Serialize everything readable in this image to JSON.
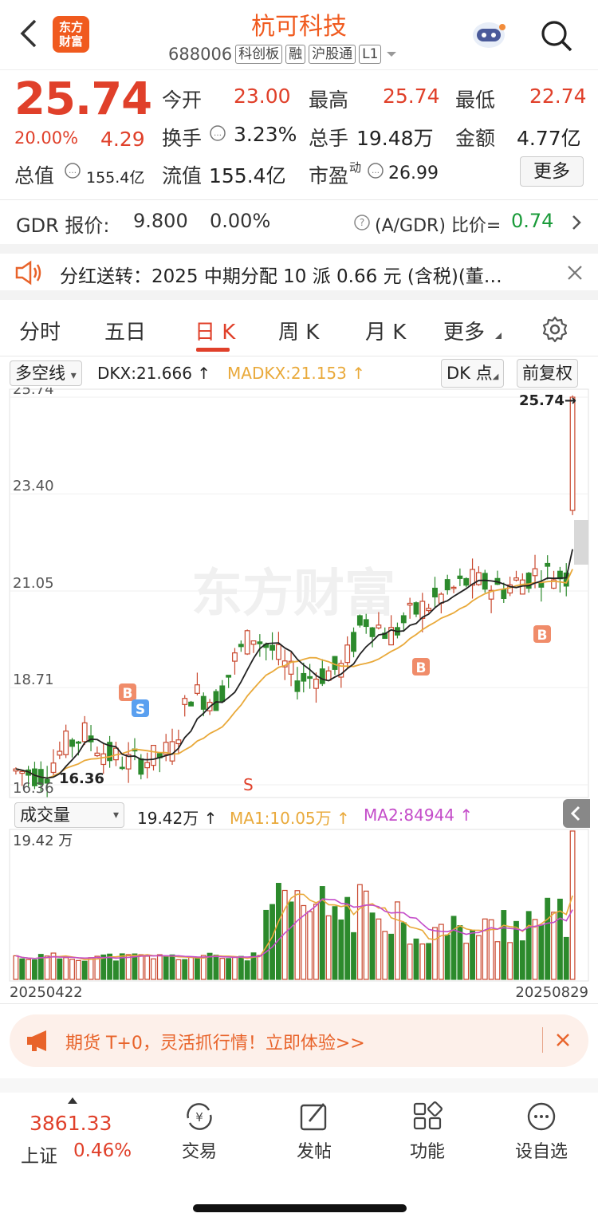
{
  "header": {
    "back_icon": "chevron-left-icon",
    "logo_text": "东方\n财富",
    "title": "杭可科技",
    "code": "688006",
    "tags": [
      "科创板",
      "融",
      "沪股通",
      "L1"
    ]
  },
  "quote": {
    "price": "25.74",
    "change_pct": "20.00%",
    "change": "4.29",
    "rows": [
      [
        {
          "label": "今开",
          "value": "23.00"
        },
        {
          "label": "最高",
          "value": "25.74"
        },
        {
          "label": "最低",
          "value": "22.74"
        }
      ],
      [
        {
          "label": "换手",
          "value": "3.23%"
        },
        {
          "label": "总手",
          "value": "19.48万"
        },
        {
          "label": "金额",
          "value": "4.77亿"
        }
      ],
      [
        {
          "label": "总值",
          "value": "155.4亿"
        },
        {
          "label": "流值",
          "value": "155.4亿"
        },
        {
          "label": "市盈",
          "sup": "动",
          "value": "26.99"
        }
      ]
    ],
    "more_label": "更多"
  },
  "gdr": {
    "label": "GDR 报价:",
    "price": "9.800",
    "pct": "0.00%",
    "ratio_label": "(A/GDR) 比价=",
    "ratio": "0.74"
  },
  "notice": {
    "text": "分红送转：2025 中期分配 10 派 0.66 元 (含税)(董…"
  },
  "tabs": [
    "分时",
    "五日",
    "日 K",
    "周 K",
    "月 K",
    "更多"
  ],
  "active_tab": "日 K",
  "indicator": {
    "selector": "多空线",
    "dkx": "DKX:21.666",
    "madkx": "MADKX:21.153",
    "dk_btn": "DK 点",
    "adjust_btn": "前复权"
  },
  "volume_bar": {
    "selector": "成交量",
    "vol": "19.42万",
    "ma1": "MA1:10.05万",
    "ma2": "MA2:84944",
    "axis_top": "19.42 万"
  },
  "chart_data": {
    "type": "candlestick",
    "y_ticks": [
      "25.74",
      "23.40",
      "21.05",
      "18.71",
      "16.36"
    ],
    "ylim": [
      16.36,
      25.74
    ],
    "high_label": "25.74",
    "low_label": "16.36",
    "x_start": "20250422",
    "x_end": "20250829",
    "markers": [
      "B",
      "S",
      "B",
      "B",
      "S"
    ],
    "watermark": "东方财富",
    "colors": {
      "up": "#c9482e",
      "down": "#2c8a2c",
      "dkx": "#222222",
      "madkx": "#e9a93a",
      "vol_ma1": "#e9a93a",
      "vol_ma2": "#c44cc9"
    }
  },
  "promo": {
    "text": "期货 T+0，灵活抓行情！立即体验>>"
  },
  "bottom_nav": {
    "index_value": "3861.33",
    "index_name": "上证",
    "index_pct": "0.46%",
    "items": [
      {
        "icon": "trade-icon",
        "label": "交易"
      },
      {
        "icon": "post-icon",
        "label": "发帖"
      },
      {
        "icon": "function-icon",
        "label": "功能"
      },
      {
        "icon": "favorite-icon",
        "label": "设自选"
      }
    ]
  }
}
